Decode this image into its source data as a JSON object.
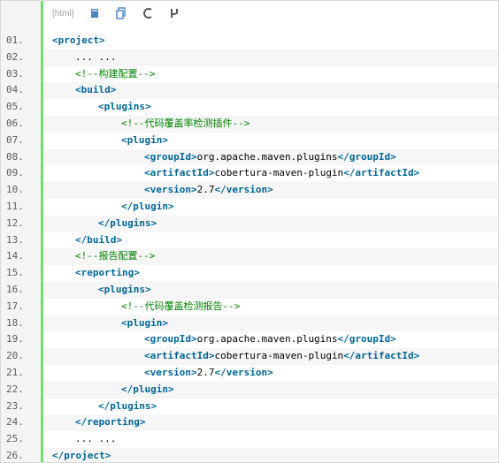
{
  "toolbar": {
    "lang_label": "[html]",
    "tools": [
      {
        "name": "view-source-icon",
        "glyph": "▮"
      },
      {
        "name": "copy-icon",
        "glyph": "⎘"
      },
      {
        "name": "wrap-icon",
        "glyph": "C"
      },
      {
        "name": "fork-icon",
        "glyph": "⑂"
      }
    ]
  },
  "lines": [
    {
      "num": "01.",
      "indent": 0,
      "parts": [
        {
          "t": "tag",
          "v": "<project>"
        }
      ]
    },
    {
      "num": "02.",
      "indent": 1,
      "parts": [
        {
          "t": "txt",
          "v": "... ..."
        }
      ]
    },
    {
      "num": "03.",
      "indent": 1,
      "parts": [
        {
          "t": "cmt",
          "v": "<!--构建配置-->"
        }
      ]
    },
    {
      "num": "04.",
      "indent": 1,
      "parts": [
        {
          "t": "tag",
          "v": "<build>"
        }
      ]
    },
    {
      "num": "05.",
      "indent": 2,
      "parts": [
        {
          "t": "tag",
          "v": "<plugins>"
        }
      ]
    },
    {
      "num": "06.",
      "indent": 3,
      "parts": [
        {
          "t": "cmt",
          "v": "<!--代码覆盖率检测插件-->"
        }
      ]
    },
    {
      "num": "07.",
      "indent": 3,
      "parts": [
        {
          "t": "tag",
          "v": "<plugin>"
        }
      ]
    },
    {
      "num": "08.",
      "indent": 4,
      "parts": [
        {
          "t": "tag",
          "v": "<groupId>"
        },
        {
          "t": "txt",
          "v": "org.apache.maven.plugins"
        },
        {
          "t": "tag",
          "v": "</groupId>"
        }
      ]
    },
    {
      "num": "09.",
      "indent": 4,
      "parts": [
        {
          "t": "tag",
          "v": "<artifactId>"
        },
        {
          "t": "txt",
          "v": "cobertura-maven-plugin"
        },
        {
          "t": "tag",
          "v": "</artifactId>"
        }
      ]
    },
    {
      "num": "10.",
      "indent": 4,
      "parts": [
        {
          "t": "tag",
          "v": "<version>"
        },
        {
          "t": "txt",
          "v": "2.7"
        },
        {
          "t": "tag",
          "v": "</version>"
        }
      ]
    },
    {
      "num": "11.",
      "indent": 3,
      "parts": [
        {
          "t": "tag",
          "v": "</plugin>"
        }
      ]
    },
    {
      "num": "12.",
      "indent": 2,
      "parts": [
        {
          "t": "tag",
          "v": "</plugins>"
        }
      ]
    },
    {
      "num": "13.",
      "indent": 1,
      "parts": [
        {
          "t": "tag",
          "v": "</build>"
        }
      ]
    },
    {
      "num": "14.",
      "indent": 1,
      "parts": [
        {
          "t": "cmt",
          "v": "<!--报告配置-->"
        }
      ]
    },
    {
      "num": "15.",
      "indent": 1,
      "parts": [
        {
          "t": "tag",
          "v": "<reporting>"
        }
      ]
    },
    {
      "num": "16.",
      "indent": 2,
      "parts": [
        {
          "t": "tag",
          "v": "<plugins>"
        }
      ]
    },
    {
      "num": "17.",
      "indent": 3,
      "parts": [
        {
          "t": "cmt",
          "v": "<!--代码覆盖检测报告-->"
        }
      ]
    },
    {
      "num": "18.",
      "indent": 3,
      "parts": [
        {
          "t": "tag",
          "v": "<plugin>"
        }
      ]
    },
    {
      "num": "19.",
      "indent": 4,
      "parts": [
        {
          "t": "tag",
          "v": "<groupId>"
        },
        {
          "t": "txt",
          "v": "org.apache.maven.plugins"
        },
        {
          "t": "tag",
          "v": "</groupId>"
        }
      ]
    },
    {
      "num": "20.",
      "indent": 4,
      "parts": [
        {
          "t": "tag",
          "v": "<artifactId>"
        },
        {
          "t": "txt",
          "v": "cobertura-maven-plugin"
        },
        {
          "t": "tag",
          "v": "</artifactId>"
        }
      ]
    },
    {
      "num": "21.",
      "indent": 4,
      "parts": [
        {
          "t": "tag",
          "v": "<version>"
        },
        {
          "t": "txt",
          "v": "2.7"
        },
        {
          "t": "tag",
          "v": "</version>"
        }
      ]
    },
    {
      "num": "22.",
      "indent": 3,
      "parts": [
        {
          "t": "tag",
          "v": "</plugin>"
        }
      ]
    },
    {
      "num": "23.",
      "indent": 2,
      "parts": [
        {
          "t": "tag",
          "v": "</plugins>"
        }
      ]
    },
    {
      "num": "24.",
      "indent": 1,
      "parts": [
        {
          "t": "tag",
          "v": "</reporting>"
        }
      ]
    },
    {
      "num": "25.",
      "indent": 1,
      "parts": [
        {
          "t": "txt",
          "v": "... ..."
        }
      ]
    },
    {
      "num": "26.",
      "indent": 0,
      "parts": [
        {
          "t": "tag",
          "v": "</project>"
        }
      ]
    }
  ],
  "colors": {
    "tag": "#006699",
    "comment": "#008200",
    "gutter_border": "#6ce26c",
    "gutter_bg": "#f4f4f4"
  }
}
